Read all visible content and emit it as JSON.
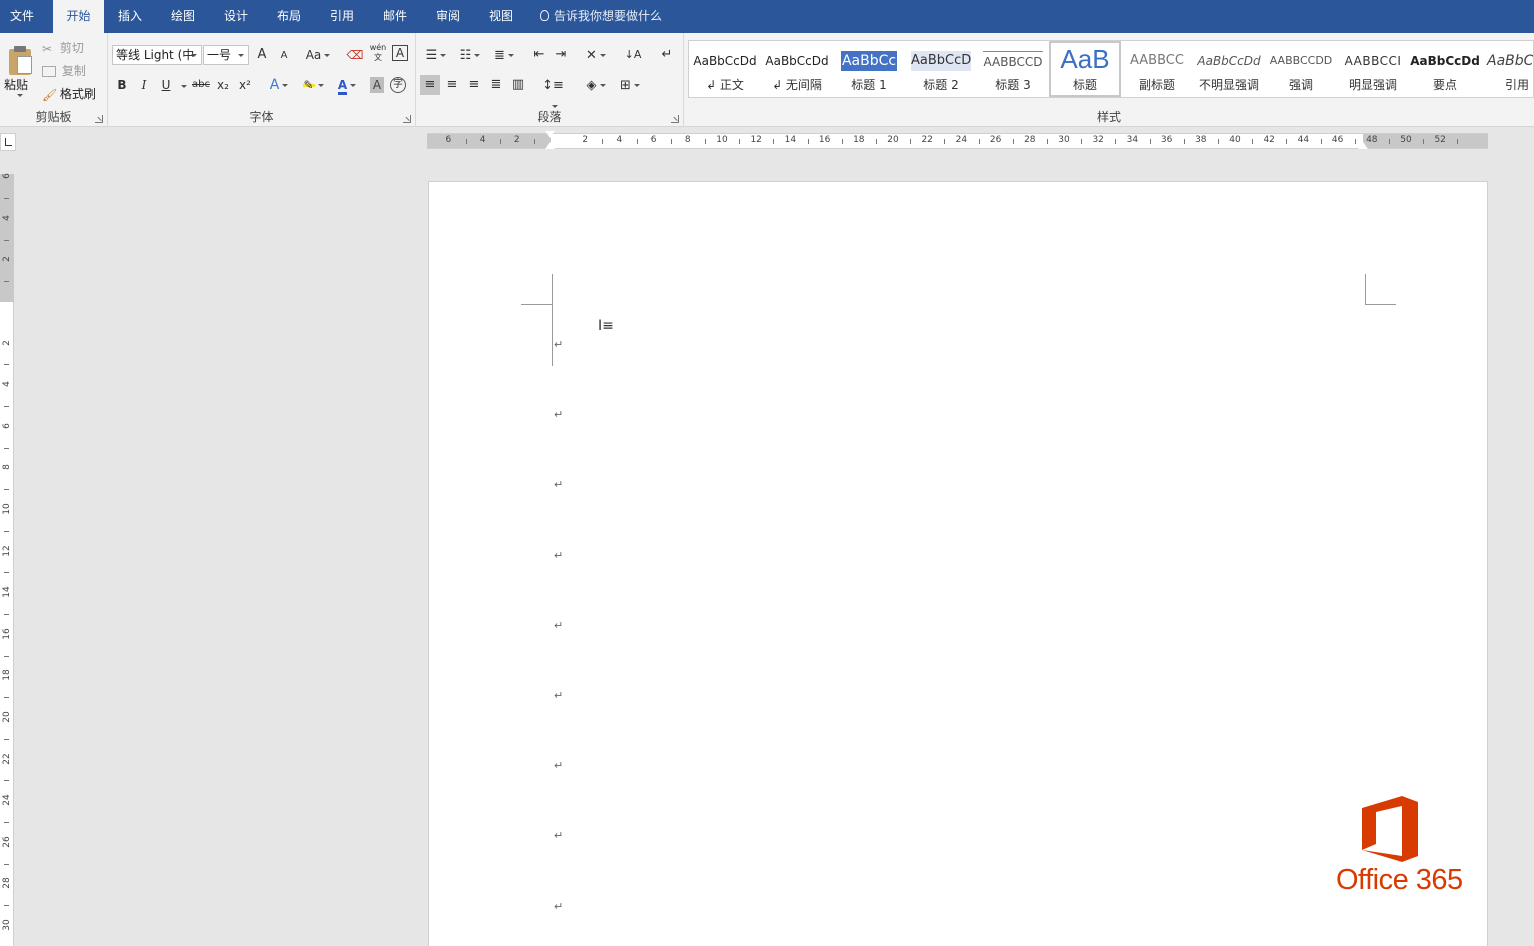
{
  "tabs": [
    {
      "label": "文件"
    },
    {
      "label": "开始"
    },
    {
      "label": "插入"
    },
    {
      "label": "绘图"
    },
    {
      "label": "设计"
    },
    {
      "label": "布局"
    },
    {
      "label": "引用"
    },
    {
      "label": "邮件"
    },
    {
      "label": "审阅"
    },
    {
      "label": "视图"
    }
  ],
  "active_tab": "开始",
  "tell_me": "告诉我你想要做什么",
  "clipboard": {
    "paste": "粘贴",
    "cut": "剪切",
    "copy": "复制",
    "format_painter": "格式刷",
    "group_label": "剪贴板"
  },
  "font": {
    "family": "等线 Light (中",
    "size": "一号",
    "grow": "A",
    "shrink": "A",
    "case": "Aa",
    "phonetic": "wén",
    "bold": "B",
    "italic": "I",
    "underline": "U",
    "strike": "abc",
    "subscript": "x₂",
    "superscript": "x²",
    "effects": "A",
    "color": "A",
    "shading": "A",
    "group_label": "字体"
  },
  "paragraph": {
    "group_label": "段落"
  },
  "styles": {
    "group_label": "样式",
    "items": [
      {
        "preview": "AaBbCcDd",
        "name": "↲ 正文"
      },
      {
        "preview": "AaBbCcDd",
        "name": "↲ 无间隔"
      },
      {
        "preview": "AaBbCc",
        "name": "标题 1"
      },
      {
        "preview": "AaBbCcD",
        "name": "标题 2"
      },
      {
        "preview": "AABBCCD",
        "name": "标题 3"
      },
      {
        "preview": "AaB",
        "name": "标题"
      },
      {
        "preview": "AABBCC",
        "name": "副标题"
      },
      {
        "preview": "AaBbCcDd",
        "name": "不明显强调"
      },
      {
        "preview": "AABBCCDD",
        "name": "强调"
      },
      {
        "preview": "AABBCCI",
        "name": "明显强调"
      },
      {
        "preview": "AaBbCcDd",
        "name": "要点"
      },
      {
        "preview": "AaBbCc",
        "name": "引用"
      }
    ]
  },
  "ruler": {
    "h_ticks": [
      "6",
      "4",
      "2",
      "2",
      "4",
      "6",
      "8",
      "10",
      "12",
      "14",
      "16",
      "18",
      "20",
      "22",
      "24",
      "26",
      "28",
      "30",
      "32",
      "34",
      "36",
      "38",
      "40",
      "42",
      "44",
      "46",
      "48",
      "50",
      "52"
    ],
    "v_ticks": [
      "6",
      "4",
      "2",
      "2",
      "4",
      "6",
      "8",
      "10",
      "12",
      "14",
      "16",
      "18",
      "20",
      "22",
      "24",
      "26",
      "28",
      "30"
    ]
  },
  "document": {
    "paragraph_mark": "↵",
    "paragraph_count": 9
  },
  "logo": {
    "text": "Office 365",
    "color": "#d83b01"
  },
  "colors": {
    "ribbon_blue": "#2b579a",
    "ribbon_bg": "#f3f3f3",
    "canvas": "#e6e6e6"
  }
}
